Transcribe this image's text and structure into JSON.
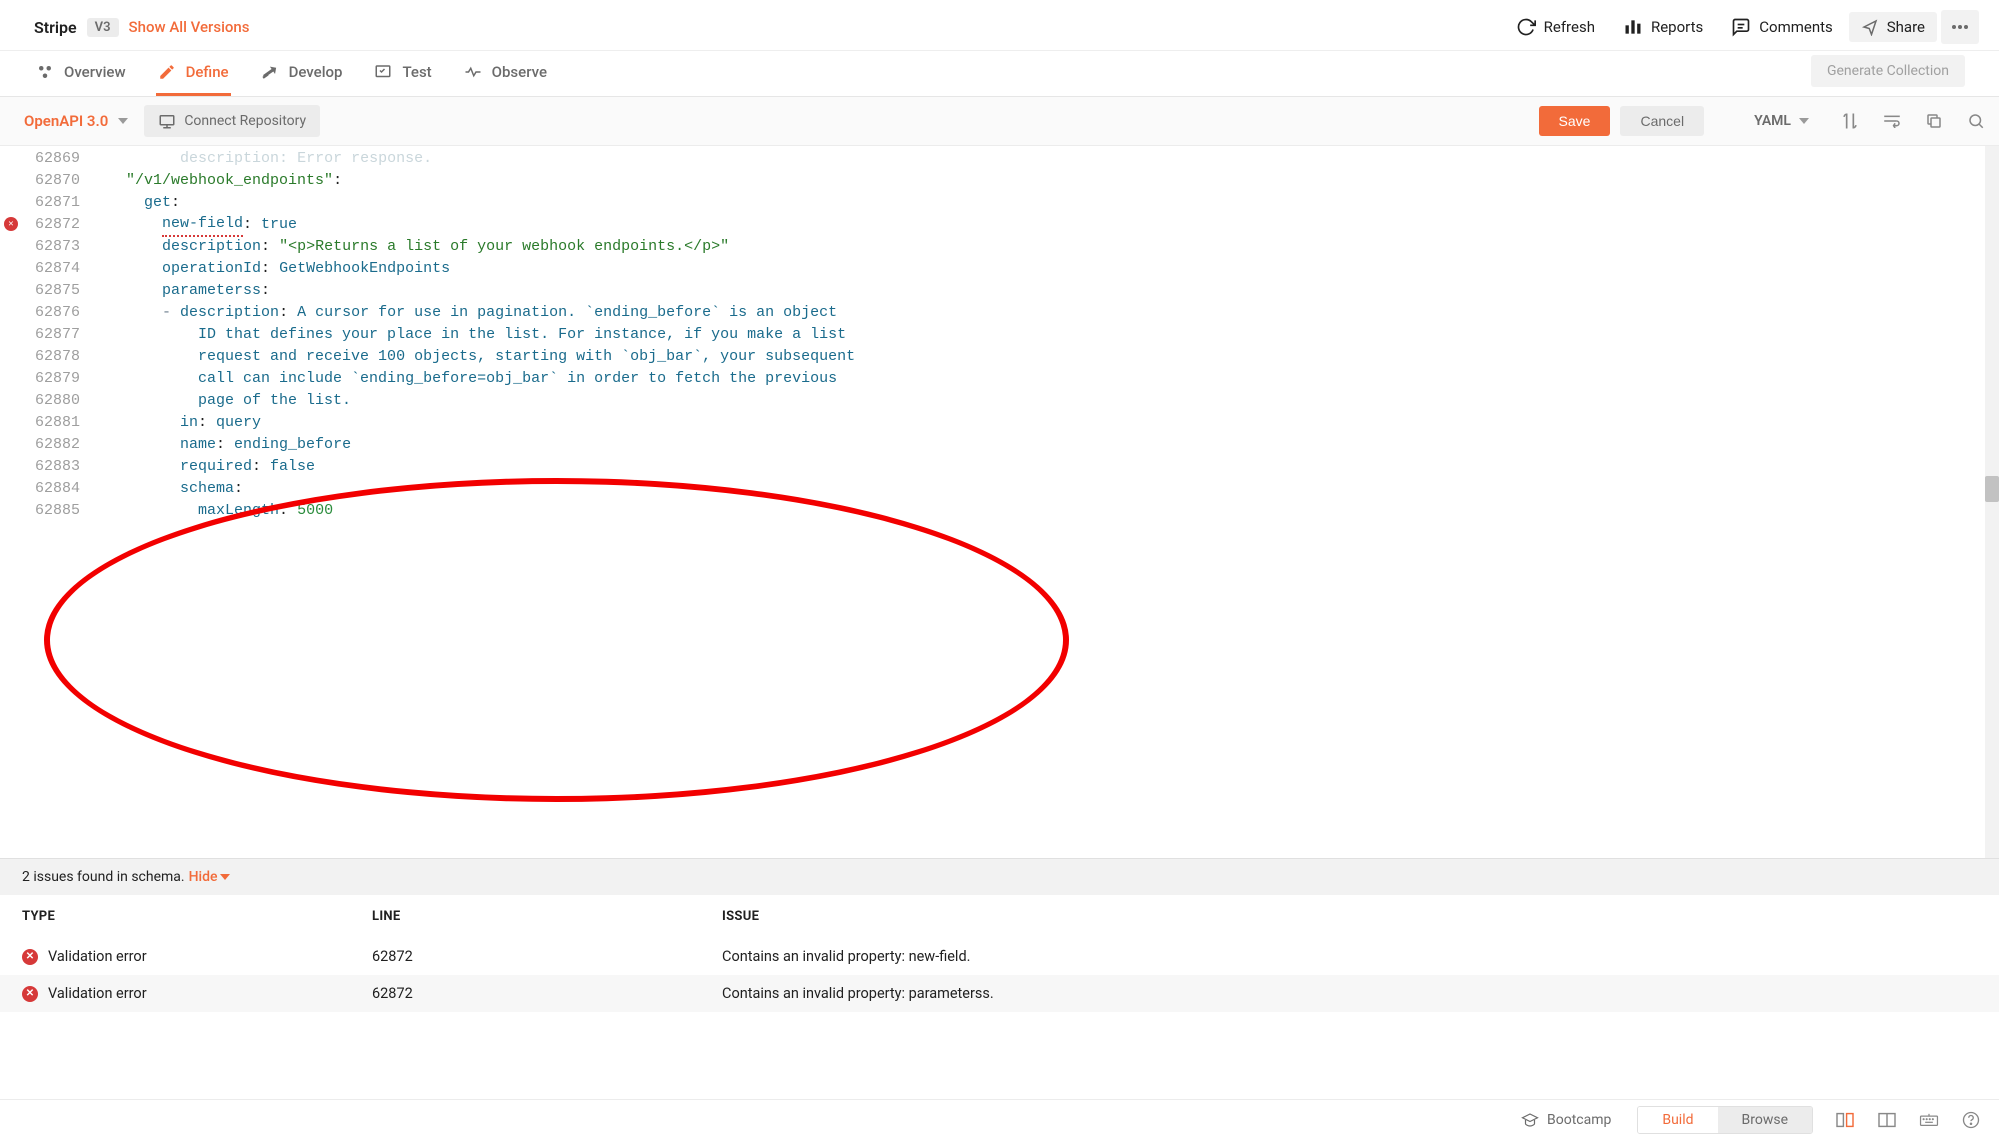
{
  "header": {
    "api_name": "Stripe",
    "version": "V3",
    "show_all": "Show All Versions",
    "refresh": "Refresh",
    "reports": "Reports",
    "comments": "Comments",
    "share": "Share"
  },
  "tabs": {
    "overview": "Overview",
    "define": "Define",
    "develop": "Develop",
    "test": "Test",
    "observe": "Observe",
    "generate": "Generate Collection"
  },
  "toolbar": {
    "spec": "OpenAPI 3.0",
    "connect_repo": "Connect Repository",
    "save": "Save",
    "cancel": "Cancel",
    "language": "YAML"
  },
  "editor": {
    "lines": [
      {
        "n": "62869",
        "err": false,
        "indent": "          ",
        "tokens": [
          {
            "c": "tk-faded",
            "t": "description"
          },
          {
            "c": "tk-faded",
            "t": ": "
          },
          {
            "c": "tk-faded",
            "t": "Error response."
          }
        ]
      },
      {
        "n": "62870",
        "err": false,
        "indent": "    ",
        "tokens": [
          {
            "c": "tk-str",
            "t": "\"/v1/webhook_endpoints\""
          },
          {
            "c": "",
            "t": ":"
          }
        ]
      },
      {
        "n": "62871",
        "err": false,
        "indent": "      ",
        "tokens": [
          {
            "c": "tk-key",
            "t": "get"
          },
          {
            "c": "",
            "t": ":"
          }
        ]
      },
      {
        "n": "62872",
        "err": true,
        "indent": "        ",
        "tokens": [
          {
            "c": "tk-key squiggly",
            "t": "new-field"
          },
          {
            "c": "",
            "t": ": "
          },
          {
            "c": "tk-bool",
            "t": "true"
          }
        ]
      },
      {
        "n": "62873",
        "err": false,
        "indent": "        ",
        "tokens": [
          {
            "c": "tk-key",
            "t": "description"
          },
          {
            "c": "",
            "t": ": "
          },
          {
            "c": "tk-str",
            "t": "\"<p>Returns a list of your webhook endpoints.</p>\""
          }
        ]
      },
      {
        "n": "62874",
        "err": false,
        "indent": "        ",
        "tokens": [
          {
            "c": "tk-key",
            "t": "operationId"
          },
          {
            "c": "",
            "t": ": "
          },
          {
            "c": "tk-txt",
            "t": "GetWebhookEndpoints"
          }
        ]
      },
      {
        "n": "62875",
        "err": false,
        "indent": "        ",
        "tokens": [
          {
            "c": "tk-key",
            "t": "parameterss"
          },
          {
            "c": "",
            "t": ":"
          }
        ]
      },
      {
        "n": "62876",
        "err": false,
        "indent": "        ",
        "tokens": [
          {
            "c": "tk-op",
            "t": "- "
          },
          {
            "c": "tk-key",
            "t": "description"
          },
          {
            "c": "",
            "t": ": "
          },
          {
            "c": "tk-txt",
            "t": "A cursor for use in pagination. `ending_before` is an object"
          }
        ]
      },
      {
        "n": "62877",
        "err": false,
        "indent": "            ",
        "tokens": [
          {
            "c": "tk-txt",
            "t": "ID that defines your place in the list. For instance, if you make a list"
          }
        ]
      },
      {
        "n": "62878",
        "err": false,
        "indent": "            ",
        "tokens": [
          {
            "c": "tk-txt",
            "t": "request and receive 100 objects, starting with `obj_bar`, your subsequent"
          }
        ]
      },
      {
        "n": "62879",
        "err": false,
        "indent": "            ",
        "tokens": [
          {
            "c": "tk-txt",
            "t": "call can include `ending_before=obj_bar` in order to fetch the previous"
          }
        ]
      },
      {
        "n": "62880",
        "err": false,
        "indent": "            ",
        "tokens": [
          {
            "c": "tk-txt",
            "t": "page of the list."
          }
        ]
      },
      {
        "n": "62881",
        "err": false,
        "indent": "          ",
        "tokens": [
          {
            "c": "tk-key",
            "t": "in"
          },
          {
            "c": "",
            "t": ": "
          },
          {
            "c": "tk-txt",
            "t": "query"
          }
        ]
      },
      {
        "n": "62882",
        "err": false,
        "indent": "          ",
        "tokens": [
          {
            "c": "tk-key",
            "t": "name"
          },
          {
            "c": "",
            "t": ": "
          },
          {
            "c": "tk-txt",
            "t": "ending_before"
          }
        ]
      },
      {
        "n": "62883",
        "err": false,
        "indent": "          ",
        "tokens": [
          {
            "c": "tk-key",
            "t": "required"
          },
          {
            "c": "",
            "t": ": "
          },
          {
            "c": "tk-bool",
            "t": "false"
          }
        ]
      },
      {
        "n": "62884",
        "err": false,
        "indent": "          ",
        "tokens": [
          {
            "c": "tk-key",
            "t": "schema"
          },
          {
            "c": "",
            "t": ":"
          }
        ]
      },
      {
        "n": "62885",
        "err": false,
        "indent": "            ",
        "tokens": [
          {
            "c": "tk-key",
            "t": "maxLength"
          },
          {
            "c": "",
            "t": ": "
          },
          {
            "c": "tk-num",
            "t": "5000"
          }
        ]
      }
    ]
  },
  "issues": {
    "summary_prefix": "2 issues found in schema. ",
    "hide": "Hide",
    "headers": {
      "type": "TYPE",
      "line": "LINE",
      "issue": "ISSUE"
    },
    "rows": [
      {
        "type": "Validation error",
        "line": "62872",
        "issue": "Contains an invalid property: new-field."
      },
      {
        "type": "Validation error",
        "line": "62872",
        "issue": "Contains an invalid property: parameterss."
      }
    ]
  },
  "footer": {
    "bootcamp": "Bootcamp",
    "build": "Build",
    "browse": "Browse"
  },
  "colors": {
    "accent": "#f26b3a",
    "error": "#d63939"
  }
}
